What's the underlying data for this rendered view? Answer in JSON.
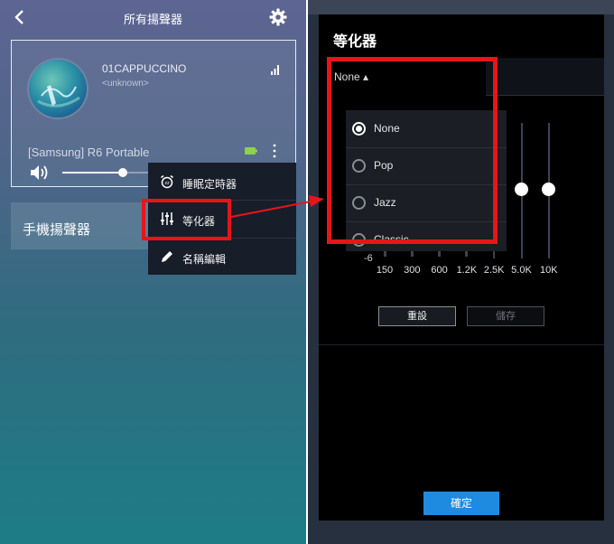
{
  "left": {
    "header": {
      "title": "所有揚聲器",
      "back_icon": "chevron-left-icon",
      "settings_icon": "gear-icon"
    },
    "speaker_card": {
      "track_title": "01CAPPUCCINO",
      "track_artist": "<unknown>",
      "device_name": "[Samsung] R6 Portable",
      "volume_fraction": 0.42,
      "battery_color": "#8ed14b"
    },
    "phone_speaker_label": "手機揚聲器",
    "context_menu": {
      "items": [
        {
          "label": "睡眠定時器",
          "icon": "alarm-clock-icon"
        },
        {
          "label": "等化器",
          "icon": "sliders-icon"
        },
        {
          "label": "名稱編輯",
          "icon": "pencil-icon"
        }
      ]
    }
  },
  "right": {
    "dialog_title": "等化器",
    "preset_selected": "None ▴",
    "preset_options": [
      {
        "label": "None",
        "selected": true
      },
      {
        "label": "Pop",
        "selected": false
      },
      {
        "label": "Jazz",
        "selected": false
      },
      {
        "label": "Classic",
        "selected": false
      }
    ],
    "db_label": "-6",
    "bands": [
      "150",
      "300",
      "600",
      "1.2K",
      "2.5K",
      "5.0K",
      "10K"
    ],
    "reset_label": "重設",
    "save_label": "儲存",
    "confirm_label": "確定"
  },
  "colors": {
    "highlight": "#e8141b",
    "confirm": "#1e8be0"
  }
}
